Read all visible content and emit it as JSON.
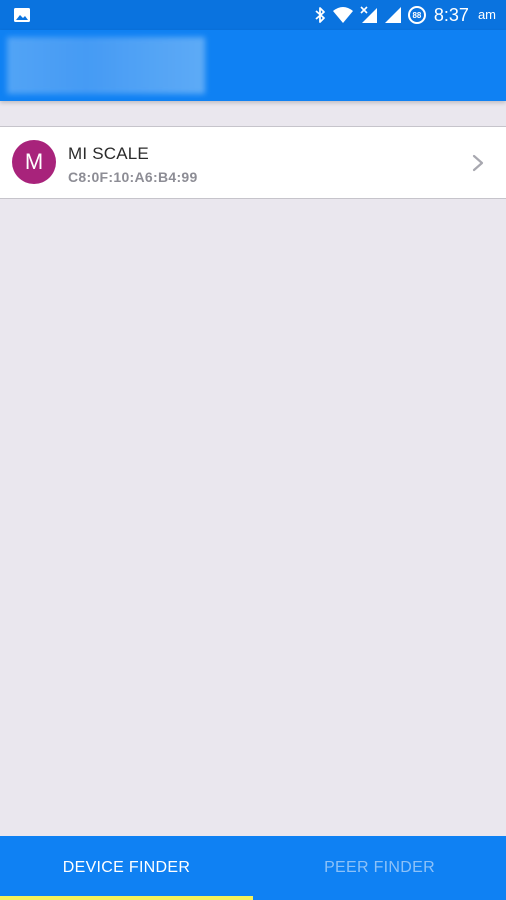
{
  "status_bar": {
    "time": "8:37",
    "ampm": "am",
    "battery_level": "88",
    "icons": [
      "gallery-icon",
      "bluetooth-icon",
      "wifi-icon",
      "signal-x-icon",
      "signal-icon",
      "battery-icon"
    ]
  },
  "app_bar": {
    "title_redacted": true
  },
  "devices": [
    {
      "avatar_letter": "M",
      "avatar_color": "#a8237b",
      "name": "MI SCALE",
      "mac": "C8:0F:10:A6:B4:99"
    }
  ],
  "tabs": [
    {
      "label": "DEVICE FINDER",
      "active": true
    },
    {
      "label": "PEER FINDER",
      "active": false
    }
  ],
  "colors": {
    "status_bar": "#0a73df",
    "app_bar": "#0f81f3",
    "background": "#eae7ee",
    "tab_indicator": "#f5f15a",
    "inactive_tab_text": "#8cc1f8"
  }
}
